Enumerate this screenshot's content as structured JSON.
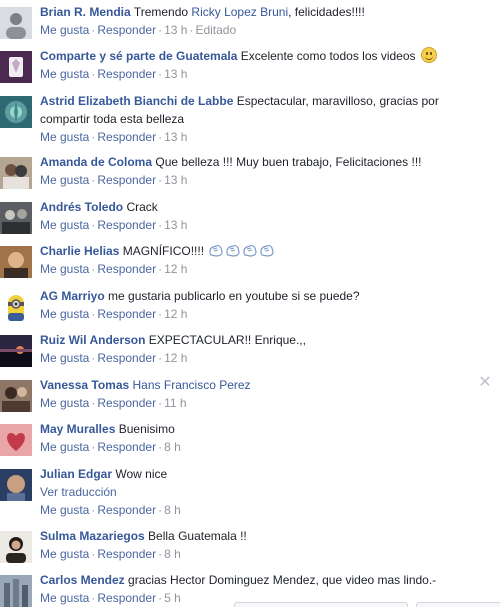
{
  "comments": [
    {
      "author": "Brian R. Mendia",
      "text_before": "Tremendo",
      "mention": "Ricky Lopez Bruni",
      "text_after": ", felicidades!!!!",
      "time": "13 h",
      "edited": "Editado"
    },
    {
      "author": "Comparte y sé parte de Guatemala",
      "text": "Excelente como todos los videos",
      "emoji": "smile-emoji",
      "time": "13 h"
    },
    {
      "author": "Astrid Elizabeth Bianchi de Labbe",
      "text": "Espectacular, maravilloso, gracias por compartir toda esta belleza",
      "time": "13 h"
    },
    {
      "author": "Amanda de Coloma",
      "text": "Que belleza !!! Muy buen trabajo, Felicitaciones !!!",
      "time": "13 h"
    },
    {
      "author": "Andrés Toledo",
      "text": "Crack",
      "time": "13 h"
    },
    {
      "author": "Charlie Helias",
      "text": "MAGNÍFICO!!!!",
      "emoji": "clapping-hands-emoji",
      "time": "12 h"
    },
    {
      "author": "AG Marriyo",
      "text": "me gustaria publicarlo en youtube si se puede?",
      "time": "12 h"
    },
    {
      "author": "Ruiz Wil Anderson",
      "text": "EXPECTACULAR!! Enrique.,,",
      "time": "12 h"
    },
    {
      "author": "Vanessa Tomas",
      "mention": "Hans Francisco Perez",
      "time": "11 h"
    },
    {
      "author": "May Muralles",
      "text": "Buenisimo",
      "time": "8 h"
    },
    {
      "author": "Julian Edgar",
      "text": "Wow nice",
      "translate": "Ver traducción",
      "time": "8 h"
    },
    {
      "author": "Sulma Mazariegos",
      "text": "Bella Guatemala !!",
      "time": "8 h"
    },
    {
      "author": "Carlos Mendez",
      "text": "gracias Hector Dominguez Mendez, que video mas lindo.-",
      "time": "5 h"
    }
  ],
  "actions": {
    "like": "Me gusta",
    "reply": "Responder",
    "separator": "·"
  },
  "close_icon": "close-icon",
  "colors": {
    "link": "#365899",
    "meta": "#90949c",
    "action": "#4b67a1",
    "text": "#1d2129"
  }
}
